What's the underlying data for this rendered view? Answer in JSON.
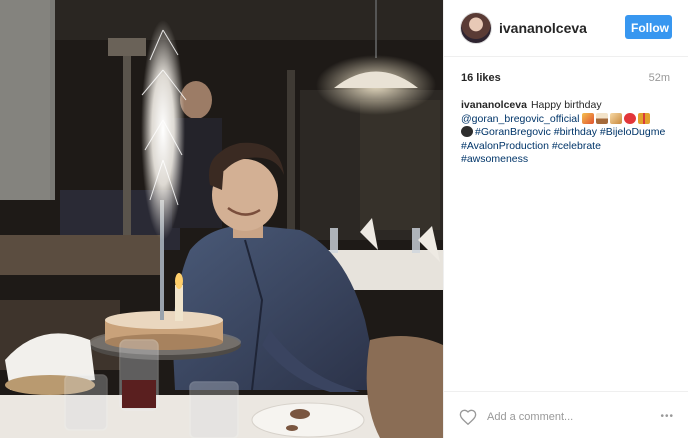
{
  "post": {
    "username": "ivananolceva",
    "follow_label": "Follow",
    "likes": "16 likes",
    "time_ago": "52m",
    "caption": {
      "username": "ivananolceva",
      "text": "Happy birthday",
      "mention": "@goran_bregovic_official",
      "hashtags": [
        "#GoranBregovic",
        "#birthday",
        "#BijeloDugme",
        "#AvalonProduction",
        "#celebrate",
        "#awsomeness"
      ]
    },
    "comment_placeholder": "Add a comment...",
    "more_label": "•••"
  },
  "colors": {
    "follow_button": "#3897f0",
    "link": "#003569",
    "muted": "#999999"
  },
  "icons": [
    "heart-icon",
    "more-options-icon"
  ]
}
